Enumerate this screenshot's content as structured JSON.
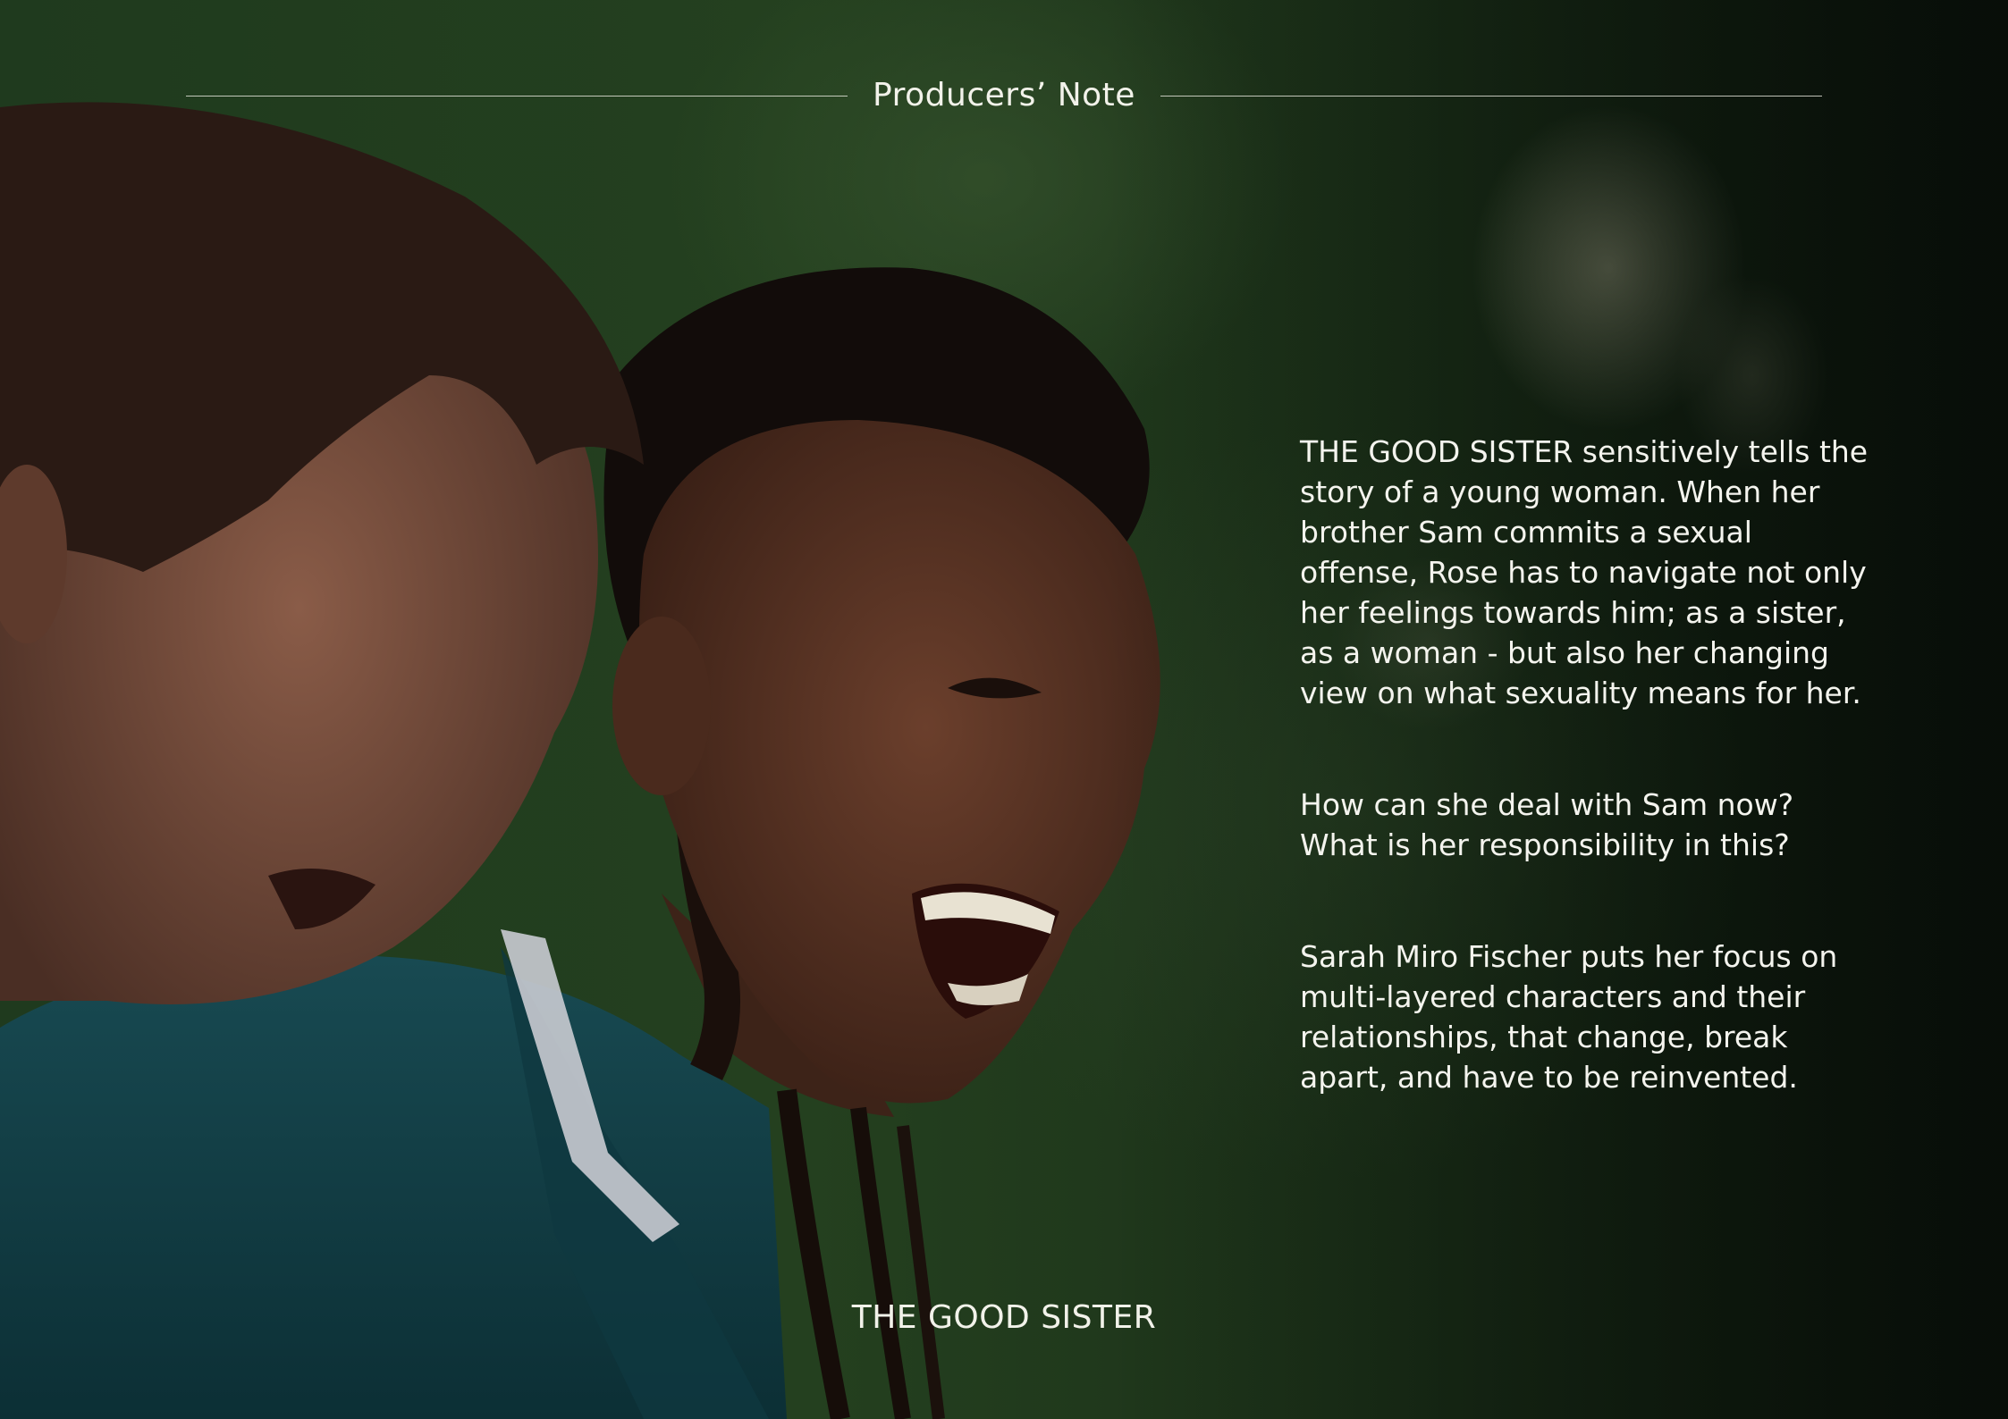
{
  "header": {
    "title": "Producers’ Note"
  },
  "body": {
    "paragraphs": [
      "THE GOOD SISTER sensitively tells the story of a young woman. When her brother Sam commits a sexual offense, Rose has to navigate not only her feelings towards him; as a sister, as a woman - but also her changing view on what sexuality means for her.",
      "How can she deal with Sam now? What is her responsibility in this?",
      "Sarah Miro Fischer puts her focus on multi-layered characters and their relationships, that change, break apart, and have to be reinvented."
    ]
  },
  "footer": {
    "title": "THE GOOD SISTER"
  },
  "colors": {
    "text": "#f4f4ee",
    "background_green": "#1f3a1e",
    "shirt_teal": "#133f45"
  }
}
